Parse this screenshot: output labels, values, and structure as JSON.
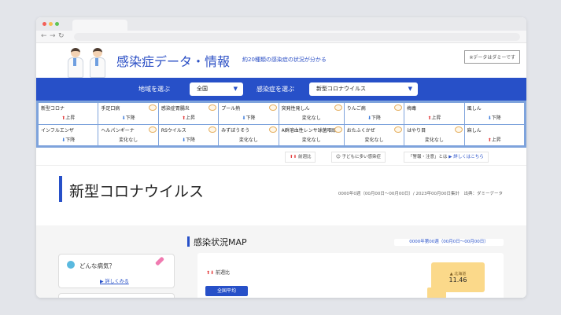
{
  "browser": {
    "back": "←",
    "forward": "→",
    "reload": "↻"
  },
  "header": {
    "site_title": "感染症データ・情報",
    "subtitle": "約20種類の感染症の状況が分かる",
    "dummy_notice": "※データはダミーです"
  },
  "selectors": {
    "region_label": "地域を選ぶ",
    "region_value": "全国",
    "disease_label": "感染症を選ぶ",
    "disease_value": "新型コロナウイルス",
    "arrow": "▼"
  },
  "diseases": [
    {
      "name": "新型コロナ",
      "trend": "上昇",
      "dir": "up",
      "child": false
    },
    {
      "name": "手足口病",
      "trend": "下降",
      "dir": "down",
      "child": true
    },
    {
      "name": "感染症胃腸炎",
      "trend": "上昇",
      "dir": "up",
      "child": true
    },
    {
      "name": "プール熱",
      "trend": "下降",
      "dir": "down",
      "child": true
    },
    {
      "name": "突発性発しん",
      "trend": "変化なし",
      "dir": "none",
      "child": true
    },
    {
      "name": "りんご病",
      "trend": "下降",
      "dir": "down",
      "child": true
    },
    {
      "name": "梅毒",
      "trend": "上昇",
      "dir": "up",
      "child": false
    },
    {
      "name": "風しん",
      "trend": "下降",
      "dir": "down",
      "child": false
    },
    {
      "name": "インフルエンザ",
      "trend": "下降",
      "dir": "down",
      "child": false
    },
    {
      "name": "ヘルパンギーナ",
      "trend": "変化なし",
      "dir": "none",
      "child": true
    },
    {
      "name": "RSウイルス",
      "trend": "下降",
      "dir": "down",
      "child": true
    },
    {
      "name": "みずぼうそう",
      "trend": "変化なし",
      "dir": "none",
      "child": true
    },
    {
      "name": "A群溶血性レンサ球菌咽頭炎",
      "trend": "変化なし",
      "dir": "none",
      "child": true
    },
    {
      "name": "おたふくかぜ",
      "trend": "変化なし",
      "dir": "none",
      "child": true
    },
    {
      "name": "はやり目",
      "trend": "変化なし",
      "dir": "none",
      "child": true
    },
    {
      "name": "麻しん",
      "trend": "上昇",
      "dir": "up",
      "child": false
    }
  ],
  "arrows": {
    "up": "⬆",
    "down": "⬇",
    "none": ""
  },
  "legend": {
    "trend_arrows": "⬆⬇",
    "trend": "前週比",
    "child": "子どもに多い感染症",
    "warning_prefix": "「警報・注意」とは",
    "warning_link": "▶ 詳しくはこちら"
  },
  "main": {
    "disease_title": "新型コロナウイルス",
    "period_meta": "0000年0週（00月00日〜00月00日）/ 2023年00月00日集計　出典：ダミーデータ"
  },
  "help": {
    "question": "どんな病気？",
    "link": "▶ 詳しくみる"
  },
  "map": {
    "title": "感染状況MAP",
    "period": "0000年第00週（00月0日〜00月00日）",
    "trend_arrows": "⬆⬇",
    "trend_label": "前週比",
    "national_avg": "全国平均",
    "hokkaido_label": "▲ 北海道",
    "hokkaido_value": "11.46"
  }
}
